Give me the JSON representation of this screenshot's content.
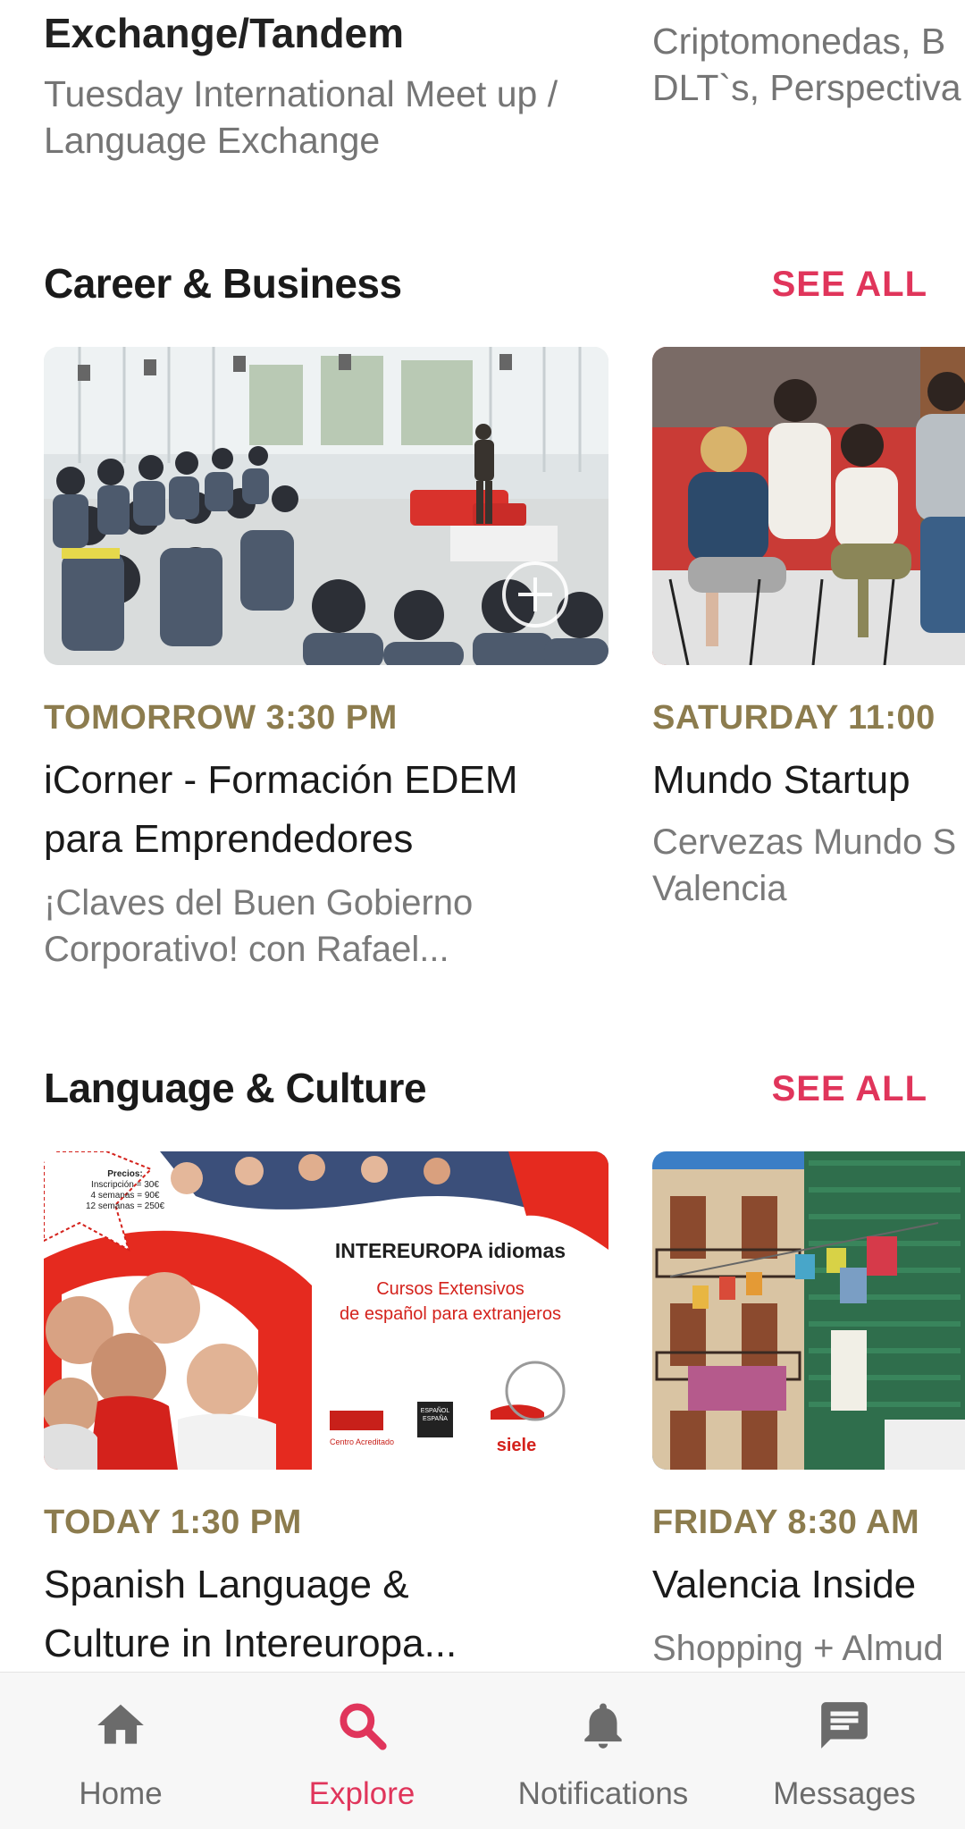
{
  "top_row": {
    "left_title": "Exchange/Tandem",
    "left_sub_1": "Tuesday International Meet up /",
    "left_sub_2": "Language Exchange",
    "right_sub_1": "Criptomonedas, B",
    "right_sub_2": "DLT`s, Perspectiva"
  },
  "sections": [
    {
      "title": "Career & Business",
      "see_all": "SEE ALL",
      "events": [
        {
          "time": "TOMORROW 3:30 PM",
          "title_1": "iCorner - Formación EDEM",
          "title_2": "para Emprendedores",
          "sub_1": "¡Claves del Buen Gobierno",
          "sub_2": "Corporativo! con Rafael..."
        },
        {
          "time": "SATURDAY 11:00",
          "title_1": "Mundo Startup",
          "sub_1": "Cervezas Mundo S",
          "sub_2": "Valencia"
        }
      ]
    },
    {
      "title": "Language & Culture",
      "see_all": "SEE ALL",
      "events": [
        {
          "time": "TODAY 1:30 PM",
          "title_1": "Spanish Language &",
          "title_2": "Culture in Intereuropa...",
          "flyer": {
            "prices_heading": "Precios:",
            "price_1": "Inscripción = 30€",
            "price_2": "4 semanas = 90€",
            "price_3": "12 semanas = 250€",
            "brand": "INTEREUROPA idiomas",
            "course_1": "Cursos Extensivos",
            "course_2": "de español para extranjeros",
            "logo_cervantes": "Centro Acreditado",
            "logo_espana": "ESPAÑOL ESPAÑA",
            "logo_siele": "siele"
          }
        },
        {
          "time": "FRIDAY 8:30 AM",
          "title_1": "Valencia Inside",
          "sub_1": "Shopping + Almud"
        }
      ]
    }
  ],
  "nav": {
    "items": [
      {
        "label": "Home",
        "icon": "home-icon"
      },
      {
        "label": "Explore",
        "icon": "search-icon"
      },
      {
        "label": "Notifications",
        "icon": "bell-icon"
      },
      {
        "label": "Messages",
        "icon": "message-icon"
      }
    ],
    "active_index": 1
  },
  "colors": {
    "accent": "#e0355b",
    "time_gold": "#8c7c4e",
    "nav_inactive": "#6b6b6b"
  }
}
